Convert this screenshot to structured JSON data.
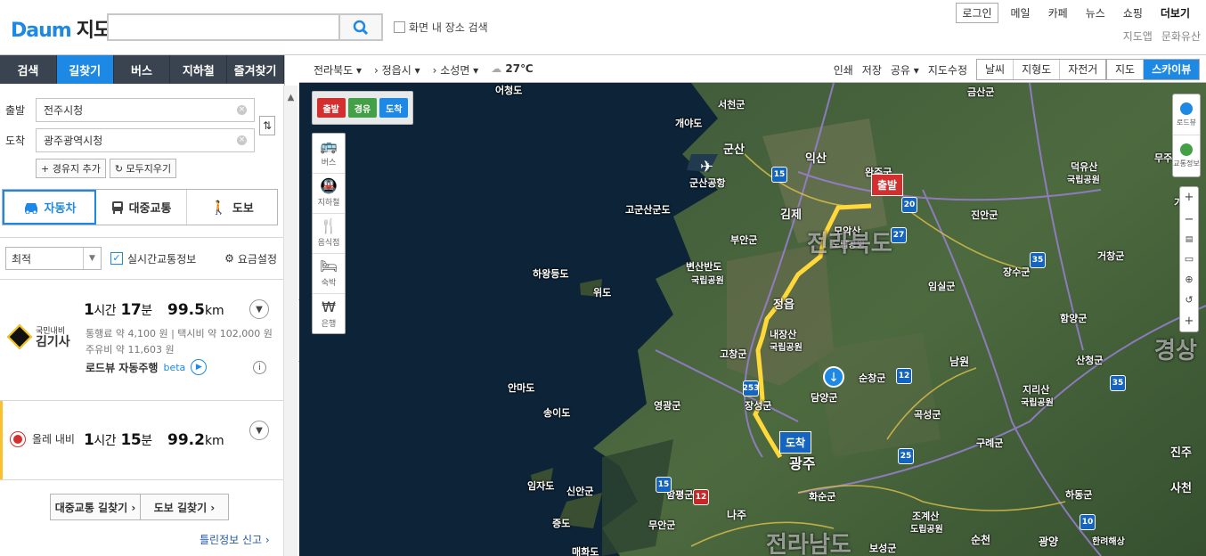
{
  "header": {
    "logo_text": "Daum",
    "logo_suffix": "지도",
    "search_placeholder": "",
    "map_search_label": "화면 내 장소 검색",
    "topnav": [
      "로그인",
      "메일",
      "카페",
      "뉴스",
      "쇼핑",
      "더보기"
    ],
    "subnav": [
      "지도앱",
      "문화유산"
    ]
  },
  "tabs": [
    "검색",
    "길찾기",
    "버스",
    "지하철",
    "즐겨찾기"
  ],
  "route": {
    "start_label": "출발",
    "start_value": "전주시청",
    "end_label": "도착",
    "end_value": "광주광역시청",
    "add_waypoint": "+ 경유지 추가",
    "clear_all": "모두지우기"
  },
  "modes": [
    "자동차",
    "대중교통",
    "도보"
  ],
  "options": {
    "sort": "최적",
    "realtime": "실시간교통정보",
    "fare": "요금설정"
  },
  "results": [
    {
      "provider_top": "국민내비",
      "provider": "김기사",
      "hours": "1",
      "h_unit": "시간",
      "mins": "17",
      "m_unit": "분",
      "distance": "99.5",
      "d_unit": "km",
      "line1": "통행료  약 4,100 원   |   택시비   약 102,000 원",
      "line2": "주유비   약 11,603 원",
      "roadview": "로드뷰 자동주행",
      "beta": "beta"
    },
    {
      "provider": "올레 내비",
      "hours": "1",
      "h_unit": "시간",
      "mins": "15",
      "m_unit": "분",
      "distance": "99.2",
      "d_unit": "km"
    }
  ],
  "bottom": {
    "transit_btn": "대중교통 길찾기 ›",
    "walk_btn": "도보 길찾기 ›",
    "report": "틀린정보 신고"
  },
  "maptoolbar": {
    "region1": "전라북도",
    "region2": "정읍시",
    "region3": "소성면",
    "temp": "27℃",
    "tools": [
      "인쇄",
      "저장",
      "공유",
      "지도수정"
    ],
    "layers": [
      "날씨",
      "지형도",
      "자전거"
    ],
    "maptypes": [
      "지도",
      "스카이뷰"
    ]
  },
  "map": {
    "flags": [
      "출발",
      "경유",
      "도착"
    ],
    "vtools": [
      "버스",
      "지하철",
      "음식점",
      "숙박",
      "은행"
    ],
    "rtools": [
      "로드뷰",
      "교통정보"
    ],
    "start_marker": "출발",
    "end_marker": "도착",
    "labels": [
      {
        "t": "어청도"
      },
      {
        "t": "개야도"
      },
      {
        "t": "서천군"
      },
      {
        "t": "군산"
      },
      {
        "t": "군산공항"
      },
      {
        "t": "익산"
      },
      {
        "t": "완주군"
      },
      {
        "t": "김제"
      },
      {
        "t": "고군산군도"
      },
      {
        "t": "부안군"
      },
      {
        "t": "변산반도"
      },
      {
        "t": "국립공원"
      },
      {
        "t": "하왕등도"
      },
      {
        "t": "위도"
      },
      {
        "t": "정읍"
      },
      {
        "t": "모악산"
      },
      {
        "t": "도립공원"
      },
      {
        "t": "내장산"
      },
      {
        "t": "국립공원"
      },
      {
        "t": "고창군"
      },
      {
        "t": "영광군"
      },
      {
        "t": "장성군"
      },
      {
        "t": "담양군"
      },
      {
        "t": "순창군"
      },
      {
        "t": "남원"
      },
      {
        "t": "안마도"
      },
      {
        "t": "송이도"
      },
      {
        "t": "광주"
      },
      {
        "t": "화순군"
      },
      {
        "t": "나주"
      },
      {
        "t": "임자도"
      },
      {
        "t": "신안군"
      },
      {
        "t": "증도"
      },
      {
        "t": "무안군"
      },
      {
        "t": "매화도"
      },
      {
        "t": "함평군"
      },
      {
        "t": "곡성군"
      },
      {
        "t": "구례군"
      },
      {
        "t": "지리산"
      },
      {
        "t": "국립공원"
      },
      {
        "t": "진안군"
      },
      {
        "t": "장수군"
      },
      {
        "t": "임실군"
      },
      {
        "t": "덕유산"
      },
      {
        "t": "국립공원"
      },
      {
        "t": "무주군"
      },
      {
        "t": "금산군"
      },
      {
        "t": "거창군"
      },
      {
        "t": "함양군"
      },
      {
        "t": "산청군"
      },
      {
        "t": "하동군"
      },
      {
        "t": "진주"
      },
      {
        "t": "사천"
      },
      {
        "t": "광양"
      },
      {
        "t": "순천"
      },
      {
        "t": "조계산"
      },
      {
        "t": "도립공원"
      },
      {
        "t": "보성군"
      },
      {
        "t": "한려해상"
      },
      {
        "t": "가야"
      },
      {
        "t": "전라북도"
      },
      {
        "t": "전라남도"
      },
      {
        "t": "경상"
      }
    ]
  }
}
